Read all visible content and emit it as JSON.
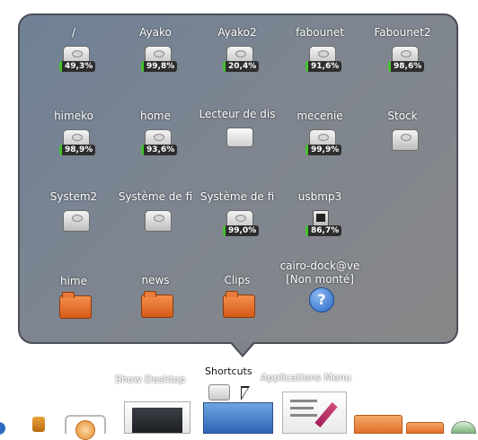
{
  "popup": {
    "rows": [
      [
        {
          "label": "/",
          "badge": "49,3%",
          "icon": "drive-icon"
        },
        {
          "label": "Ayako",
          "badge": "99,8%",
          "icon": "drive-icon"
        },
        {
          "label": "Ayako2",
          "badge": "20,4%",
          "icon": "drive-icon"
        },
        {
          "label": "fabounet",
          "badge": "91,6%",
          "icon": "drive-icon"
        },
        {
          "label": "Fabounet2",
          "badge": "98,6%",
          "icon": "drive-icon"
        }
      ],
      [
        {
          "label": "himeko",
          "badge": "98,9%",
          "icon": "drive-icon"
        },
        {
          "label": "home",
          "badge": "93,6%",
          "icon": "drive-icon"
        },
        {
          "label": "Lecteur de dis",
          "badge": "",
          "icon": "removable-drive-icon"
        },
        {
          "label": "mecenie",
          "badge": "99,9%",
          "icon": "drive-icon"
        },
        {
          "label": "Stock",
          "badge": "",
          "icon": "drive-icon"
        }
      ],
      [
        {
          "label": "System2",
          "badge": "",
          "icon": "drive-icon"
        },
        {
          "label": "Système de fi",
          "badge": "",
          "icon": "drive-icon"
        },
        {
          "label": "Système de fi",
          "badge": "99,0%",
          "icon": "drive-icon"
        },
        {
          "label": "usbmp3",
          "badge": "86,7%",
          "icon": "mp3-player-icon"
        }
      ],
      [
        {
          "label": "hime",
          "icon": "folder-icon"
        },
        {
          "label": "news",
          "icon": "folder-icon"
        },
        {
          "label": "Clips",
          "icon": "folder-icon"
        },
        {
          "label": "cairo-dock@ve",
          "label2": "[Non monté]",
          "icon": "help-icon"
        }
      ]
    ]
  },
  "dock": {
    "show_desktop": "Show Desktop",
    "shortcuts": "Shortcuts",
    "applications_menu": "Applications Menu"
  }
}
